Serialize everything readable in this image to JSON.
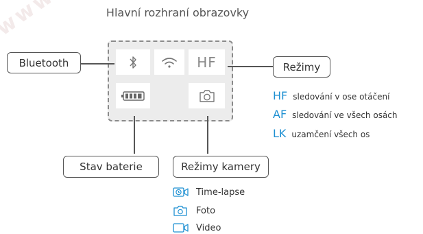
{
  "title": "Hlavní rozhraní obrazovky",
  "watermark": "www",
  "screen": {
    "hf_label": "HF"
  },
  "labels": {
    "bluetooth": "Bluetooth",
    "rezimy": "Režimy",
    "stav_baterie": "Stav baterie",
    "rezimy_kamery": "Režimy kamery"
  },
  "modes": [
    {
      "code": "HF",
      "desc": "sledování v ose otáčení"
    },
    {
      "code": "AF",
      "desc": "sledování ve všech osách"
    },
    {
      "code": "LK",
      "desc": "uzamčení všech os"
    }
  ],
  "camera_modes": [
    {
      "icon": "timelapse-icon",
      "label": "Time-lapse"
    },
    {
      "icon": "camera-icon",
      "label": "Foto"
    },
    {
      "icon": "video-icon",
      "label": "Video"
    }
  ],
  "colors": {
    "accent": "#1e90d2",
    "line": "#555555",
    "screen_bg": "#ececec"
  }
}
